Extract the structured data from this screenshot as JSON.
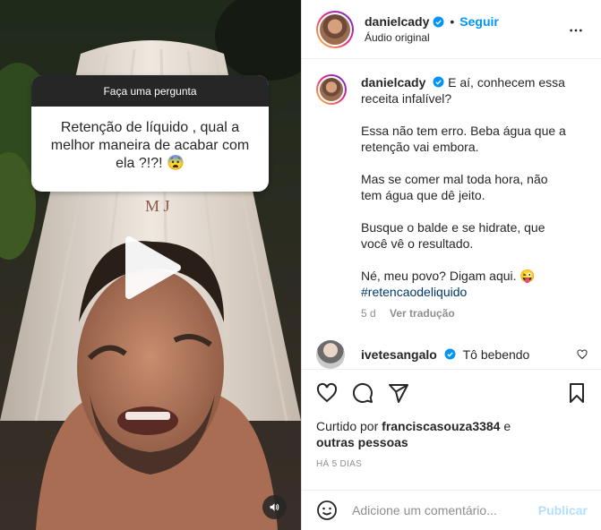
{
  "media": {
    "question_header": "Faça uma pergunta",
    "question_text": "Retenção de líquido , qual a melhor maneira de acabar com ela ?!?! 😨"
  },
  "header": {
    "username": "danielcady",
    "separator": "•",
    "follow_label": "Seguir",
    "subtitle": "Áudio original"
  },
  "caption": {
    "username": "danielcady",
    "line1": "E aí, conhecem essa receita infalível?",
    "para2": "Essa não tem erro. Beba água que a retenção vai embora.",
    "para3": "Mas se comer mal toda hora, não tem água que dê jeito.",
    "para4": "Busque o balde e se hidrate, que você vê o resultado.",
    "para5": "Né, meu povo? Digam aqui. 😜",
    "hashtag": "#retencaodeliquido",
    "age": "5 d",
    "translate_label": "Ver tradução"
  },
  "comment": {
    "username": "ivetesangalo",
    "text": "Tô bebendo"
  },
  "likes": {
    "prefix": "Curtido por",
    "user": "franciscasouza3384",
    "joiner": "e",
    "others": "outras pessoas",
    "ago": "HÁ 5 DIAS"
  },
  "add_comment": {
    "placeholder": "Adicione um comentário...",
    "publish_label": "Publicar"
  },
  "colors": {
    "link_blue": "#0095f6",
    "hashtag_blue": "#00376b",
    "publish_disabled": "#b2dffc",
    "verified_blue": "#0095f6"
  },
  "icons": [
    "play-icon",
    "audio-icon",
    "verified-icon",
    "more-icon",
    "heart-icon",
    "comment-icon",
    "share-icon",
    "bookmark-icon",
    "emoji-icon"
  ]
}
